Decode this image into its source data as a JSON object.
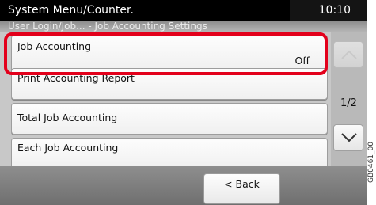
{
  "header": {
    "title": "System Menu/Counter.",
    "clock": "10:10",
    "breadcrumb": "User Login/Job... - Job Accounting Settings"
  },
  "list": {
    "items": [
      {
        "label": "Job Accounting",
        "value": "Off",
        "highlighted": true
      },
      {
        "label": "Print Accounting Report",
        "value": ""
      },
      {
        "label": "Total Job Accounting",
        "value": ""
      },
      {
        "label": "Each Job Accounting",
        "value": ""
      }
    ]
  },
  "scroll": {
    "page_indicator": "1/2",
    "up_icon": "chevron-up-icon",
    "down_icon": "chevron-down-icon"
  },
  "footer": {
    "back_label": "< Back"
  },
  "figure_code": "GB0461_00",
  "colors": {
    "highlight": "#e3001b",
    "titlebar": "#000000",
    "panel": "#c8c8c8"
  }
}
